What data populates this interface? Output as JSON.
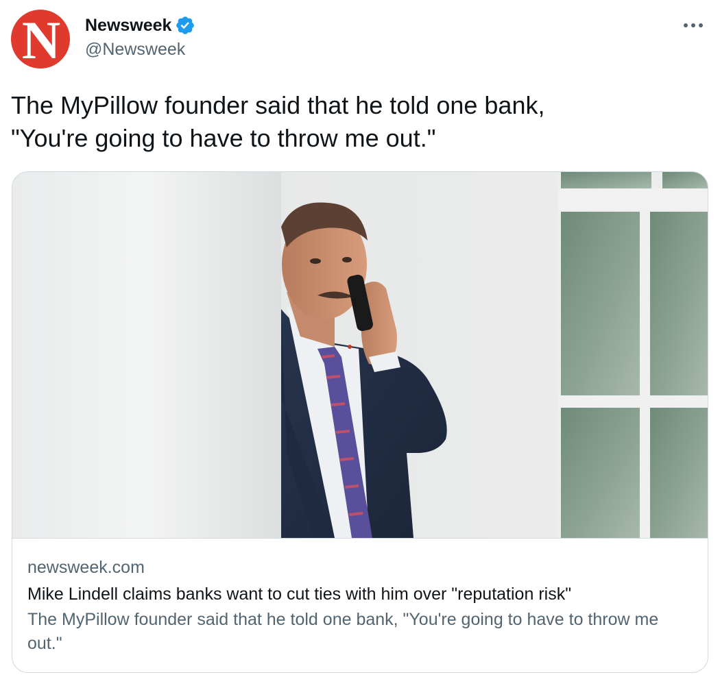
{
  "tweet": {
    "author": {
      "display_name": "Newsweek",
      "handle": "@Newsweek",
      "avatar_letter": "N",
      "avatar_color": "#e03a2f",
      "verified": true,
      "verified_color": "#1d9bf0"
    },
    "more_icon": "more-horizontal-icon",
    "text": "The MyPillow founder said that he told one bank,\n\"You're going to have to throw me out.\"",
    "card": {
      "domain": "newsweek.com",
      "title": "Mike Lindell claims banks want to cut ties with him over \"reputation risk\"",
      "description": "The MyPillow founder said that he told one bank, \"You're going to have to throw me out.\""
    }
  }
}
